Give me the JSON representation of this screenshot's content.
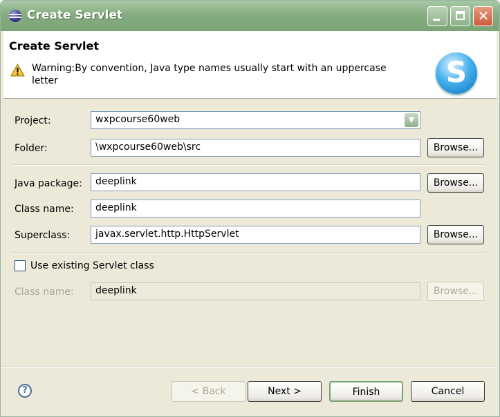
{
  "window": {
    "title": "Create Servlet",
    "minimize_icon": "minimize-icon",
    "maximize_icon": "maximize-icon",
    "close_icon": "close-icon"
  },
  "header": {
    "title": "Create Servlet",
    "warning_icon": "warning-icon",
    "warning": "Warning:By convention, Java type names usually start with an uppercase letter",
    "logo_icon": "servlet-s-logo-icon",
    "logo_letter": "S"
  },
  "form": {
    "project_label": "Project:",
    "project_value": "wxpcourse60web",
    "folder_label": "Folder:",
    "folder_value": "\\wxpcourse60web\\src",
    "browse_label": "Browse...",
    "package_label": "Java package:",
    "package_value": "deeplink",
    "class_label": "Class name:",
    "class_value": "deeplink",
    "superclass_label": "Superclass:",
    "superclass_value": "javax.servlet.http.HttpServlet",
    "use_existing_label": "Use existing Servlet class",
    "use_existing_checked": false,
    "existing_class_label": "Class name:",
    "existing_class_value": "deeplink"
  },
  "footer": {
    "help_icon": "help-icon",
    "back_label": "< Back",
    "next_label": "Next >",
    "finish_label": "Finish",
    "cancel_label": "Cancel"
  }
}
